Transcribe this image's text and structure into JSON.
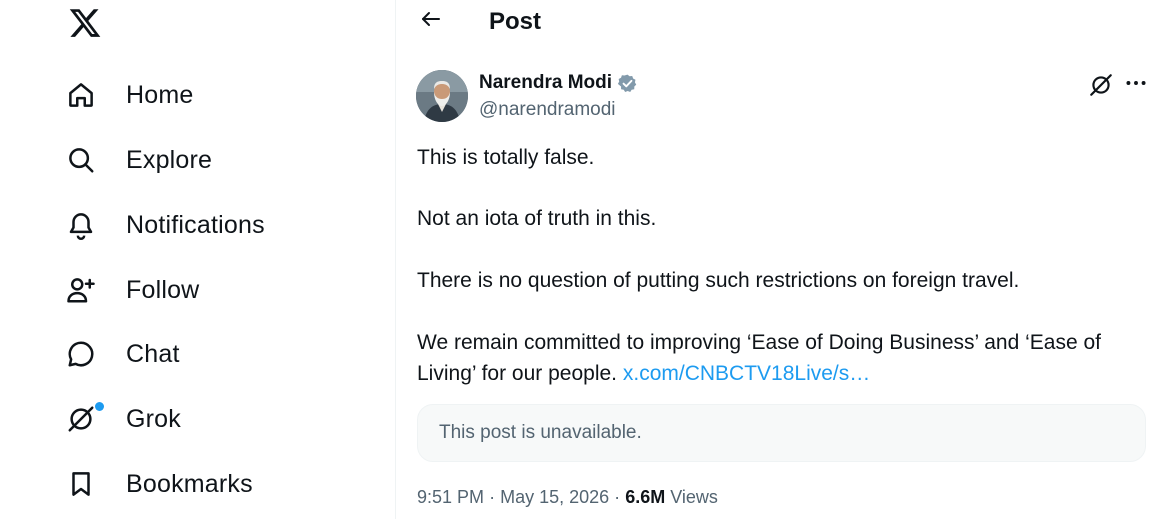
{
  "sidebar": {
    "logo_icon": "x-logo-icon",
    "items": [
      {
        "label": "Home",
        "icon": "home-icon"
      },
      {
        "label": "Explore",
        "icon": "search-icon"
      },
      {
        "label": "Notifications",
        "icon": "bell-icon"
      },
      {
        "label": "Follow",
        "icon": "person-plus-icon"
      },
      {
        "label": "Chat",
        "icon": "chat-bubble-icon"
      },
      {
        "label": "Grok",
        "icon": "grok-icon"
      },
      {
        "label": "Bookmarks",
        "icon": "bookmark-icon"
      }
    ]
  },
  "header": {
    "title": "Post"
  },
  "post": {
    "author_name": "Narendra Modi",
    "handle": "@narendramodi",
    "paragraphs": [
      "This is totally false.",
      "Not an iota of truth in this.",
      "There is no question of putting such restrictions on foreign travel.",
      "We remain committed to improving ‘Ease of Doing Business’ and ‘Ease of Living’ for our people."
    ],
    "link_text": "x.com/CNBCTV18Live/s…",
    "quote_unavailable": "This post is unavailable.",
    "time": "9:51 PM",
    "separator": "·",
    "date": "May 15, 2026",
    "views_count": "6.6M",
    "views_label": "Views"
  },
  "colors": {
    "accent": "#1d9bf0",
    "text_primary": "#0f1419",
    "text_secondary": "#536471",
    "verified_badge": "#829aab"
  }
}
